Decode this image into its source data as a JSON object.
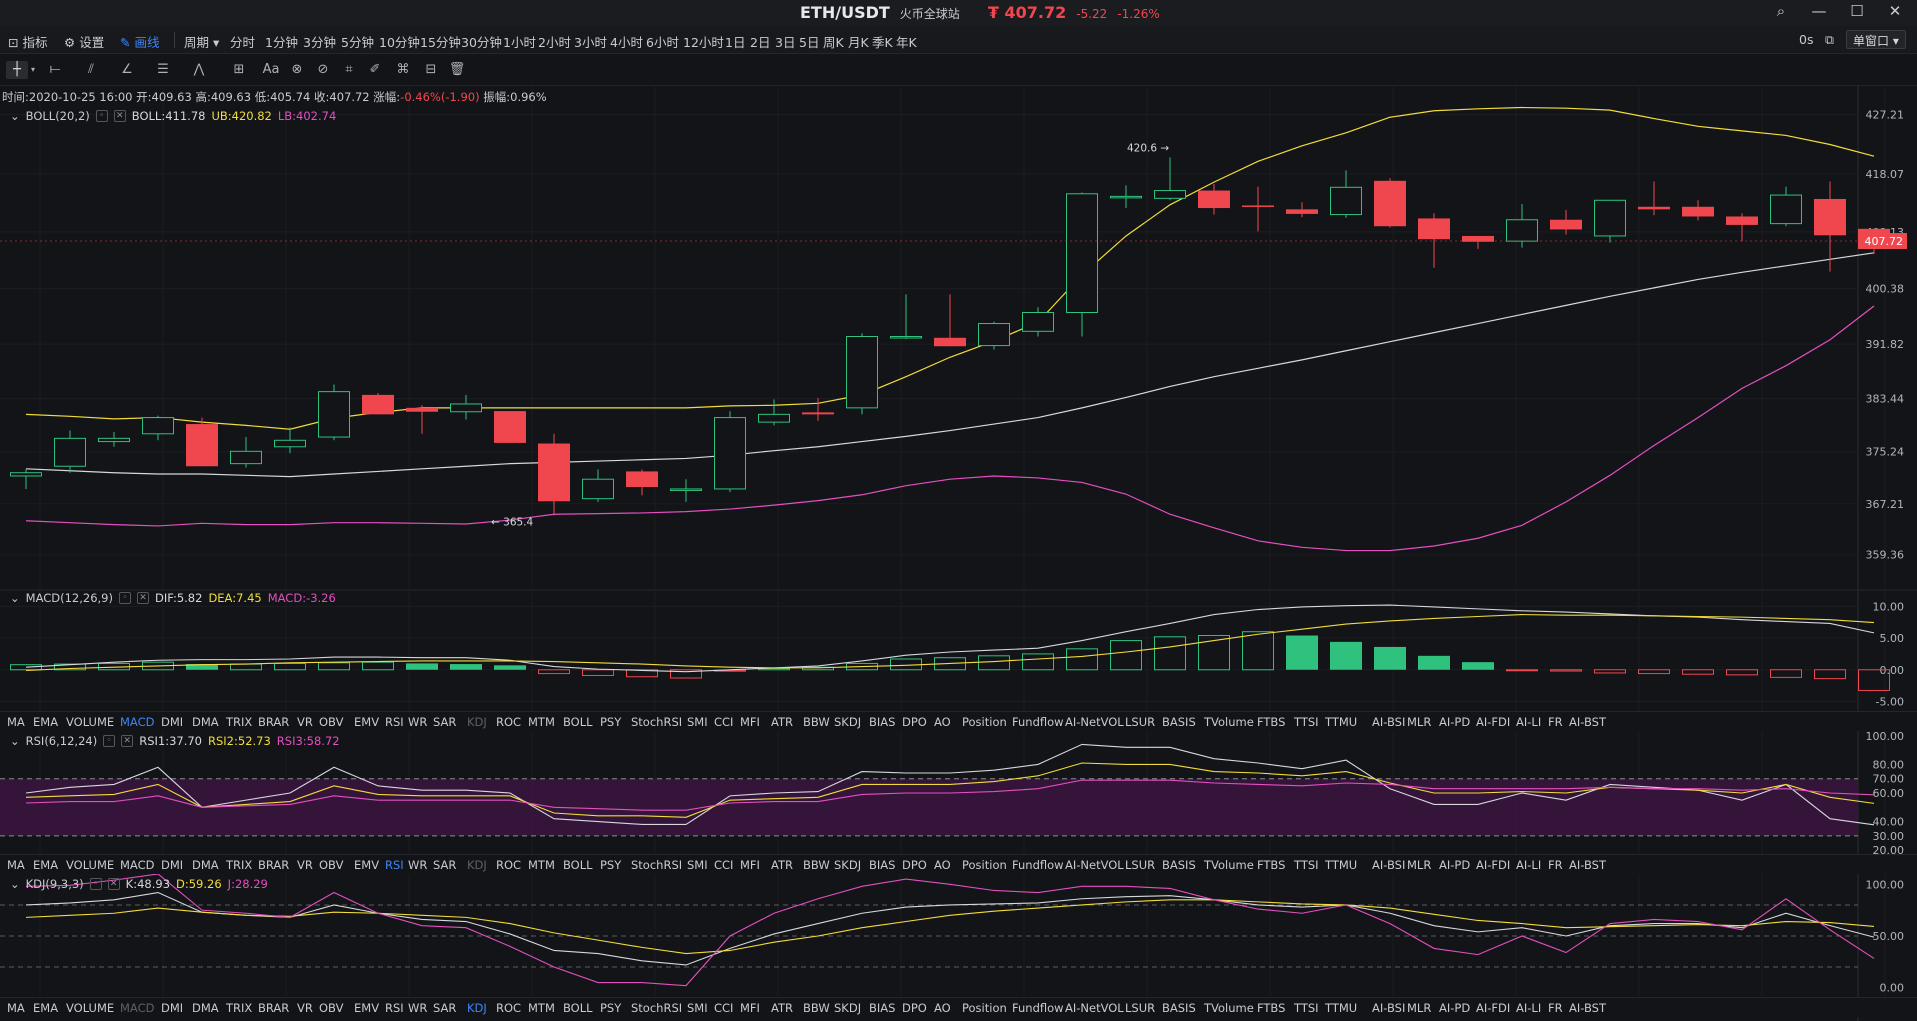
{
  "window": {
    "pair": "ETH/USDT",
    "exchange": "火币全球站",
    "price": "₮ 407.72",
    "change": "-5.22",
    "change_pct": "-1.26%",
    "controls": [
      "search-icon",
      "minimize-icon",
      "maximize-icon",
      "close-icon"
    ]
  },
  "toolbar": {
    "indicator_label": "指标",
    "settings_label": "设置",
    "draw_label": "画线",
    "period_label": "周期",
    "periods": [
      "分时",
      "1分钟",
      "3分钟",
      "5分钟",
      "10分钟",
      "15分钟",
      "30分钟",
      "1小时",
      "2小时",
      "3小时",
      "4小时",
      "6小时",
      "12小时",
      "1日",
      "2日",
      "3日",
      "5日",
      "周K",
      "月K",
      "季K",
      "年K"
    ],
    "active_period": "4小时",
    "timer": "0s",
    "window_mode": "单窗口"
  },
  "drawing_tools": [
    "crosshair-icon",
    "line-tool-icon",
    "channel-tool-icon",
    "angle-tool-icon",
    "fib-tool-icon",
    "wave-tool-icon",
    "shape-tool-icon",
    "text-tool-icon",
    "magnet-icon",
    "eye-off-icon",
    "ruler-icon",
    "pen-icon",
    "pattern-icon",
    "lock-icon",
    "trash-icon"
  ],
  "text_tool_label": "Aa",
  "ohlc_info": {
    "time": "时间:2020-10-25 16:00",
    "open": "开:409.63",
    "high": "高:409.63",
    "low": "低:405.74",
    "close": "收:407.72",
    "change_label": "涨幅:",
    "change_value": "-0.46%(-1.90)",
    "amplitude": "振幅:0.96%"
  },
  "boll_label": {
    "name": "BOLL(20,2)",
    "boll": "BOLL:411.78",
    "ub": "UB:420.82",
    "lb": "LB:402.74"
  },
  "macd_label": {
    "name": "MACD(12,26,9)",
    "dif": "DIF:5.82",
    "dea": "DEA:7.45",
    "macd": "MACD:-3.26"
  },
  "rsi_label": {
    "name": "RSI(6,12,24)",
    "rsi1": "RSI1:37.70",
    "rsi2": "RSI2:52.73",
    "rsi3": "RSI3:58.72"
  },
  "kdj_label": {
    "name": "KDJ(9,3,3)",
    "k": "K:48.93",
    "d": "D:59.26",
    "j": "J:28.29"
  },
  "indicator_tabs": [
    "MA",
    "EMA",
    "VOLUME",
    "MACD",
    "DMI",
    "DMA",
    "TRIX",
    "BRAR",
    "VR",
    "OBV",
    "EMV",
    "RSI",
    "WR",
    "SAR",
    "KDJ",
    "ROC",
    "MTM",
    "BOLL",
    "PSY",
    "StochRSI",
    "SMI",
    "CCI",
    "MFI",
    "ATR",
    "BBW",
    "SKDJ",
    "BIAS",
    "DPO",
    "AO",
    "Position",
    "Fundflow",
    "AI-NetVOL",
    "LSUR",
    "BASIS",
    "TVolume",
    "FTBS",
    "TTSI",
    "TTMU",
    "AI-BSI",
    "MLR",
    "AI-PD",
    "AI-FDI",
    "AI-LI",
    "FR",
    "AI-BST"
  ],
  "colors": {
    "up": "#2ec27e",
    "down": "#f0474e",
    "boll_mid": "#d6d8de",
    "boll_up": "#f2dc3b",
    "boll_low": "#e44fc1",
    "accent": "#3f86f5",
    "rsi_band": "#3b1540"
  },
  "chart_data": [
    {
      "type": "candlestick",
      "title": "ETH/USDT 4小时",
      "y_ticks": [
        "427.21",
        "418.07",
        "409.13",
        "400.38",
        "391.82",
        "383.44",
        "375.24",
        "367.21",
        "359.36"
      ],
      "current_price_label": "407.72",
      "annotations": [
        {
          "label": "420.6 →",
          "x": 26,
          "y": 420.6
        },
        {
          "label": "← 365.4",
          "x": 11,
          "y": 365.4
        }
      ],
      "ylim": [
        355,
        431
      ],
      "ohlc": [
        [
          371.5,
          372.5,
          369.5,
          372.0
        ],
        [
          373.0,
          378.5,
          372.0,
          377.3
        ],
        [
          376.8,
          378.3,
          376.0,
          377.3
        ],
        [
          378.0,
          380.8,
          377.0,
          380.5
        ],
        [
          379.5,
          380.5,
          373.0,
          373.0
        ],
        [
          373.4,
          377.5,
          372.8,
          375.3
        ],
        [
          376.0,
          379.0,
          375.0,
          377.0
        ],
        [
          377.5,
          385.6,
          377.0,
          384.5
        ],
        [
          384.0,
          384.3,
          381.0,
          381.0
        ],
        [
          382.0,
          382.4,
          378.0,
          381.4
        ],
        [
          381.4,
          384.0,
          380.2,
          382.6
        ],
        [
          381.5,
          381.5,
          376.6,
          376.6
        ],
        [
          376.5,
          378.0,
          365.4,
          367.6
        ],
        [
          368.0,
          372.5,
          367.5,
          371.0
        ],
        [
          372.2,
          372.5,
          368.5,
          369.8
        ],
        [
          369.5,
          371.0,
          367.5,
          369.5
        ],
        [
          369.5,
          381.5,
          369.0,
          380.5
        ],
        [
          379.8,
          383.3,
          379.3,
          381.0
        ],
        [
          381.3,
          383.5,
          380.0,
          381.0
        ],
        [
          382.0,
          393.5,
          381.0,
          393.0
        ],
        [
          393.0,
          399.5,
          392.6,
          393.0
        ],
        [
          392.8,
          399.5,
          391.5,
          391.5
        ],
        [
          391.6,
          395.3,
          391.0,
          395.0
        ],
        [
          393.8,
          397.5,
          393.0,
          396.7
        ],
        [
          396.7,
          415.2,
          393.0,
          415.0
        ],
        [
          414.6,
          416.3,
          412.8,
          414.6
        ],
        [
          414.3,
          420.6,
          414.0,
          415.5
        ],
        [
          415.5,
          416.5,
          411.8,
          412.8
        ],
        [
          413.2,
          416.1,
          409.2,
          413.0
        ],
        [
          412.6,
          413.7,
          411.4,
          411.9
        ],
        [
          411.8,
          418.6,
          411.3,
          416.0
        ],
        [
          417.0,
          417.4,
          409.8,
          410.0
        ],
        [
          411.2,
          412.0,
          403.6,
          408.0
        ],
        [
          408.5,
          408.5,
          406.5,
          407.6
        ],
        [
          407.7,
          413.4,
          406.7,
          411.0
        ],
        [
          411.0,
          412.5,
          408.7,
          409.5
        ],
        [
          408.5,
          414.0,
          407.5,
          414.0
        ],
        [
          413.0,
          416.9,
          411.7,
          412.6
        ],
        [
          413.0,
          414.0,
          410.9,
          411.5
        ],
        [
          411.5,
          412.0,
          407.7,
          410.2
        ],
        [
          410.4,
          416.1,
          410.0,
          414.8
        ],
        [
          414.2,
          416.9,
          403.0,
          408.6
        ],
        [
          409.6,
          409.6,
          405.7,
          407.7
        ]
      ],
      "series": [
        {
          "name": "BOLL",
          "values": [
            372.6,
            372.3,
            372.0,
            371.8,
            371.8,
            371.6,
            371.4,
            371.8,
            372.2,
            372.6,
            373.0,
            373.4,
            373.6,
            373.8,
            374.0,
            374.2,
            374.7,
            375.4,
            376.0,
            376.8,
            377.6,
            378.5,
            379.5,
            380.5,
            382.0,
            383.6,
            385.3,
            386.8,
            388.1,
            389.4,
            390.8,
            392.2,
            393.6,
            395.0,
            396.4,
            397.8,
            399.2,
            400.5,
            401.8,
            402.9,
            403.9,
            404.9,
            405.9
          ]
        },
        {
          "name": "UB",
          "values": [
            381.0,
            380.7,
            380.3,
            380.5,
            379.8,
            379.3,
            378.7,
            380.4,
            381.3,
            382.0,
            382.0,
            382.0,
            382.0,
            382.0,
            382.0,
            382.0,
            382.3,
            382.4,
            382.7,
            384.0,
            386.8,
            389.8,
            392.3,
            395.2,
            402.5,
            408.5,
            413.3,
            416.8,
            420.0,
            422.4,
            424.4,
            426.8,
            427.8,
            428.1,
            428.3,
            428.2,
            427.9,
            426.6,
            425.4,
            424.7,
            424.0,
            422.6,
            420.8
          ]
        },
        {
          "name": "LB",
          "values": [
            364.6,
            364.3,
            364.0,
            363.8,
            364.2,
            364.0,
            364.0,
            364.3,
            364.3,
            364.2,
            364.1,
            364.7,
            365.6,
            365.7,
            365.8,
            366.0,
            366.4,
            367.0,
            367.7,
            368.6,
            370.0,
            371.0,
            371.5,
            371.2,
            370.5,
            368.7,
            365.6,
            363.5,
            361.5,
            360.5,
            360.0,
            360.0,
            360.7,
            361.9,
            363.9,
            367.5,
            371.6,
            376.2,
            380.5,
            385.0,
            388.5,
            392.5,
            397.7
          ]
        }
      ]
    },
    {
      "type": "bar+line",
      "title": "MACD(12,26,9)",
      "y_ticks": [
        "10.00",
        "5.00",
        "0.00",
        "-5.00"
      ],
      "ylim": [
        -6.5,
        11
      ],
      "series": [
        {
          "name": "MACD",
          "values": [
            0.8,
            0.9,
            1.0,
            1.2,
            0.9,
            0.9,
            1.0,
            1.1,
            1.2,
            1.0,
            0.9,
            0.7,
            -0.6,
            -0.9,
            -1.1,
            -1.3,
            -0.3,
            0.2,
            0.4,
            1.0,
            1.7,
            1.9,
            2.2,
            2.5,
            3.3,
            4.6,
            5.2,
            5.4,
            6.0,
            5.4,
            4.4,
            3.6,
            2.2,
            1.2,
            -0.1,
            -0.2,
            -0.5,
            -0.6,
            -0.7,
            -0.8,
            -1.2,
            -1.4,
            -3.26
          ]
        },
        {
          "name": "DIF",
          "values": [
            0.4,
            0.8,
            1.2,
            1.5,
            1.6,
            1.6,
            1.7,
            2.0,
            2.0,
            1.9,
            1.9,
            1.5,
            0.5,
            0.1,
            -0.1,
            -0.3,
            0.0,
            0.3,
            0.6,
            1.4,
            2.3,
            2.8,
            3.1,
            3.4,
            4.6,
            6.0,
            7.3,
            8.7,
            9.5,
            9.9,
            10.1,
            10.2,
            9.9,
            9.6,
            9.3,
            9.1,
            8.8,
            8.5,
            8.3,
            7.9,
            7.6,
            7.3,
            5.82
          ]
        },
        {
          "name": "DEA",
          "values": [
            -0.1,
            0.2,
            0.4,
            0.6,
            0.8,
            0.9,
            1.1,
            1.2,
            1.3,
            1.4,
            1.4,
            1.4,
            1.3,
            1.1,
            0.9,
            0.6,
            0.4,
            0.3,
            0.3,
            0.5,
            0.7,
            1.0,
            1.3,
            1.7,
            2.1,
            2.8,
            3.6,
            4.6,
            5.6,
            6.4,
            7.2,
            7.7,
            8.1,
            8.4,
            8.7,
            8.6,
            8.6,
            8.5,
            8.4,
            8.3,
            8.1,
            7.9,
            7.45
          ]
        }
      ]
    },
    {
      "type": "line",
      "title": "RSI(6,12,24)",
      "y_ticks": [
        "100.00",
        "80.00",
        "70.00",
        "60.00",
        "40.00",
        "30.00",
        "20.00"
      ],
      "ylim": [
        18,
        102
      ],
      "band": [
        30,
        70
      ],
      "series": [
        {
          "name": "RSI1",
          "values": [
            60,
            64,
            66,
            78,
            50,
            55,
            60,
            78,
            65,
            62,
            62,
            60,
            42,
            40,
            38,
            38,
            58,
            60,
            61,
            75,
            74,
            74,
            76,
            80,
            94,
            92,
            92,
            84,
            81,
            77,
            83,
            63,
            52,
            52,
            60,
            55,
            66,
            64,
            62,
            55,
            66,
            42,
            37.7
          ]
        },
        {
          "name": "RSI2",
          "values": [
            57,
            58,
            59,
            66,
            50,
            52,
            54,
            65,
            59,
            58,
            58,
            58,
            46,
            44,
            44,
            43,
            55,
            56,
            57,
            66,
            66,
            66,
            68,
            72,
            81,
            80,
            80,
            75,
            74,
            72,
            75,
            67,
            60,
            60,
            61,
            60,
            64,
            63,
            62,
            60,
            66,
            57,
            52.73
          ]
        },
        {
          "name": "RSI3",
          "values": [
            53,
            54,
            54,
            58,
            50,
            51,
            52,
            58,
            55,
            55,
            55,
            55,
            50,
            49,
            48,
            48,
            53,
            54,
            54,
            59,
            60,
            60,
            61,
            63,
            69,
            69,
            69,
            67,
            66,
            65,
            67,
            66,
            63,
            63,
            63,
            63,
            64,
            63,
            63,
            62,
            63,
            60,
            58.72
          ]
        }
      ]
    },
    {
      "type": "line",
      "title": "KDJ(9,3,3)",
      "y_ticks": [
        "100.00",
        "50.00",
        "0.00"
      ],
      "ylim": [
        -8,
        108
      ],
      "guides": [
        20,
        50,
        80
      ],
      "series": [
        {
          "name": "K",
          "values": [
            80,
            82,
            85,
            92,
            73,
            70,
            68,
            80,
            72,
            66,
            64,
            52,
            36,
            33,
            26,
            22,
            38,
            52,
            62,
            72,
            78,
            80,
            81,
            82,
            86,
            88,
            89,
            85,
            80,
            78,
            80,
            72,
            60,
            54,
            58,
            50,
            60,
            62,
            62,
            58,
            72,
            60,
            48.93
          ]
        },
        {
          "name": "D",
          "values": [
            68,
            70,
            72,
            77,
            73,
            70,
            69,
            73,
            72,
            70,
            68,
            62,
            53,
            46,
            39,
            33,
            36,
            44,
            50,
            58,
            64,
            70,
            74,
            77,
            80,
            83,
            85,
            85,
            83,
            81,
            80,
            77,
            71,
            65,
            62,
            58,
            59,
            60,
            61,
            60,
            64,
            63,
            59.26
          ]
        },
        {
          "name": "J",
          "values": [
            98,
            99,
            104,
            110,
            75,
            72,
            68,
            92,
            72,
            60,
            58,
            40,
            20,
            5,
            5,
            2,
            50,
            72,
            86,
            98,
            105,
            100,
            94,
            92,
            98,
            98,
            96,
            85,
            76,
            72,
            80,
            62,
            38,
            32,
            50,
            34,
            62,
            66,
            64,
            56,
            86,
            56,
            28.29
          ]
        }
      ]
    }
  ]
}
